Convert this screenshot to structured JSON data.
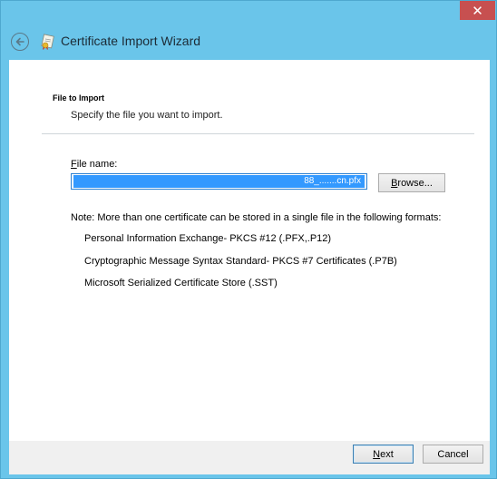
{
  "window": {
    "title": "Certificate Import Wizard",
    "close_glyph": "✕"
  },
  "page": {
    "heading": "File to Import",
    "subheading": "Specify the file you want to import."
  },
  "file_field": {
    "label_accel": "F",
    "label_rest": "ile name:",
    "value": "88_.......cn.pfx"
  },
  "browse": {
    "accel": "B",
    "rest": "rowse..."
  },
  "note": "Note:  More than one certificate can be stored in a single file in the following formats:",
  "formats": [
    "Personal Information Exchange- PKCS #12 (.PFX,.P12)",
    "Cryptographic Message Syntax Standard- PKCS #7 Certificates (.P7B)",
    "Microsoft Serialized Certificate Store (.SST)"
  ],
  "buttons": {
    "next_accel": "N",
    "next_rest": "ext",
    "cancel": "Cancel"
  },
  "icons": {
    "back": "back-arrow-icon",
    "certificate": "certificate-icon",
    "close": "close-icon"
  },
  "colors": {
    "title_bg": "#6ac5ea",
    "close_bg": "#c75050",
    "selection": "#3399ff"
  }
}
